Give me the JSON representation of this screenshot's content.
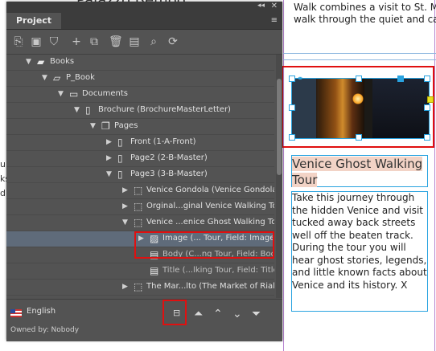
{
  "document": {
    "top_heading": "Palazzo Bemoo",
    "top_text_line1": "Walk combines a visit to St. Mark's",
    "top_text_line2": "walk through the quiet and captiva",
    "headline": "Venice Ghost Walking Tour",
    "body": "Take this journey through the hidden Venice and visit tucked away back streets well off the beaten track. During the tour you will hear ghost stories, legends, and little known facts about Venice and its history. X",
    "left_fragments": [
      "ulu",
      "ks",
      "di"
    ]
  },
  "panel": {
    "tab_label": "Project",
    "collapse_glyph": "◂◂",
    "close_glyph": "✕",
    "menu_glyph": "≡",
    "toolbar_icons": [
      "check-out-icon",
      "save-icon",
      "check-in-icon",
      "add-icon",
      "move-icon",
      "delete-icon",
      "properties-icon",
      "locate-icon",
      "refresh-icon"
    ],
    "tree": [
      {
        "label": "Books",
        "indent": 0,
        "expanded": true,
        "icon": "books-icon"
      },
      {
        "label": "P_Book",
        "indent": 1,
        "expanded": true,
        "icon": "book-icon"
      },
      {
        "label": "Documents",
        "indent": 2,
        "expanded": true,
        "icon": "folder-icon"
      },
      {
        "label": "Brochure (BrochureMasterLetter)",
        "indent": 3,
        "expanded": true,
        "icon": "document-icon"
      },
      {
        "label": "Pages",
        "indent": 4,
        "expanded": true,
        "icon": "pages-icon"
      },
      {
        "label": "Front (1-A-Front)",
        "indent": 5,
        "expanded": false,
        "icon": "page-icon"
      },
      {
        "label": "Page2 (2-B-Master)",
        "indent": 5,
        "expanded": false,
        "icon": "page-icon"
      },
      {
        "label": "Page3 (3-B-Master)",
        "indent": 5,
        "expanded": true,
        "icon": "page-icon"
      },
      {
        "label": "Venice Gondola (Venice Gondola)",
        "indent": 6,
        "expanded": false,
        "icon": "component-icon"
      },
      {
        "label": "Orginal...ginal Venice Walking Tour)",
        "indent": 6,
        "expanded": false,
        "icon": "component-icon"
      },
      {
        "label": "Venice ...enice Ghost Walking Tour)",
        "indent": 6,
        "expanded": true,
        "icon": "component-icon"
      },
      {
        "label": "Image (... Tour, Field: Image)",
        "indent": 7,
        "expanded": false,
        "icon": "image-icon",
        "selected": true
      },
      {
        "label": "Body (C...ng Tour, Field: Body)",
        "indent": 7,
        "expanded": null,
        "icon": "text-icon"
      },
      {
        "label": "Title (...lking Tour, Field: Title)",
        "indent": 7,
        "expanded": null,
        "icon": "text-icon"
      },
      {
        "label": "The Mar...lto (The Market of Rialto)",
        "indent": 6,
        "expanded": false,
        "icon": "component-icon"
      }
    ],
    "footer": {
      "language": "English",
      "owned_by": "Owned by: Nobody"
    },
    "colors": {
      "accent_red": "#e01010",
      "selection": "#5f6b7a",
      "frame_blue": "#29a3e0"
    }
  }
}
